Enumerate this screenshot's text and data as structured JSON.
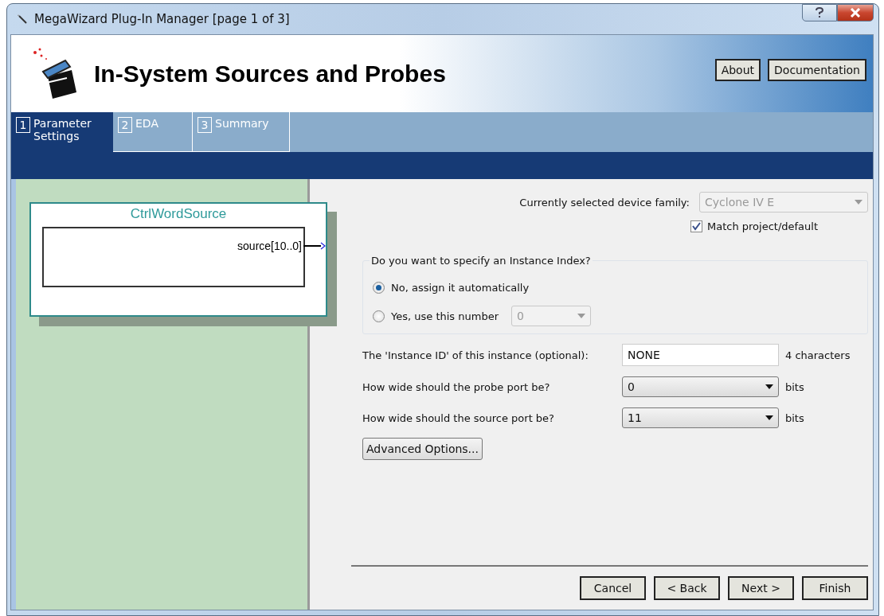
{
  "window": {
    "title": "MegaWizard Plug-In Manager [page 1 of 3]"
  },
  "header": {
    "title": "In-System Sources and Probes",
    "buttons": [
      "About",
      "Documentation"
    ]
  },
  "tabs": [
    {
      "number": "1",
      "label": "Parameter Settings",
      "selected": true
    },
    {
      "number": "2",
      "label": "EDA",
      "selected": false
    },
    {
      "number": "3",
      "label": "Summary",
      "selected": false
    }
  ],
  "diagram": {
    "block_name": "CtrlWordSource",
    "port": "source[10..0]"
  },
  "device_family": {
    "label": "Currently selected device family:",
    "value": "Cyclone IV E",
    "disabled": true
  },
  "match_checkbox": {
    "label": "Match project/default",
    "checked": true
  },
  "instance_index": {
    "legend": "Do you want to specify an Instance Index?",
    "options": [
      {
        "label": "No, assign it automatically",
        "selected": true
      },
      {
        "label": "Yes, use this number",
        "selected": false,
        "dropdown": {
          "value": "0",
          "disabled": true
        }
      }
    ]
  },
  "instance_id": {
    "label": "The 'Instance ID' of this instance (optional):",
    "value": "NONE",
    "note": "4 characters"
  },
  "port_widths": [
    {
      "label": "How wide should the probe port be?",
      "value": "0",
      "unit": "bits"
    },
    {
      "label": "How wide should the source port be?",
      "value": "11",
      "unit": "bits"
    }
  ],
  "advanced_button": "Advanced Options...",
  "nav_buttons": [
    "Cancel",
    "< Back",
    "Next >",
    "Finish"
  ]
}
